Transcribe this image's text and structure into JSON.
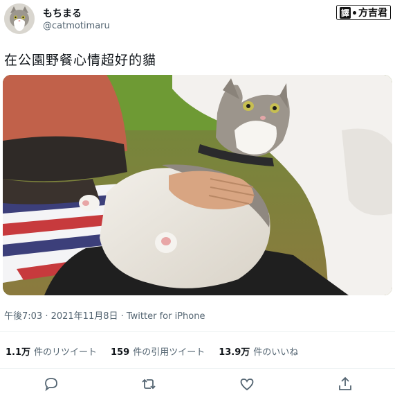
{
  "user": {
    "display_name": "もちまる",
    "handle": "@catmotimaru"
  },
  "translator_badge": {
    "icon": "translate-glyph",
    "label": "方吉君",
    "prefix": "譯"
  },
  "tweet": {
    "text": "在公園野餐心情超好的貓",
    "image_subject": "cat",
    "timestamp": "午後7:03 · 2021年11月8日 · Twitter for iPhone"
  },
  "stats": [
    {
      "value": "1.1万",
      "label": "件のリツイート"
    },
    {
      "value": "159",
      "label": "件の引用ツイート"
    },
    {
      "value": "13.9万",
      "label": "件のいいね"
    }
  ],
  "actions": [
    {
      "icon": "reply-icon"
    },
    {
      "icon": "retweet-icon"
    },
    {
      "icon": "like-icon"
    },
    {
      "icon": "share-icon"
    }
  ],
  "colors": {
    "secondary_text": "#536471",
    "divider": "#eff3f4"
  }
}
